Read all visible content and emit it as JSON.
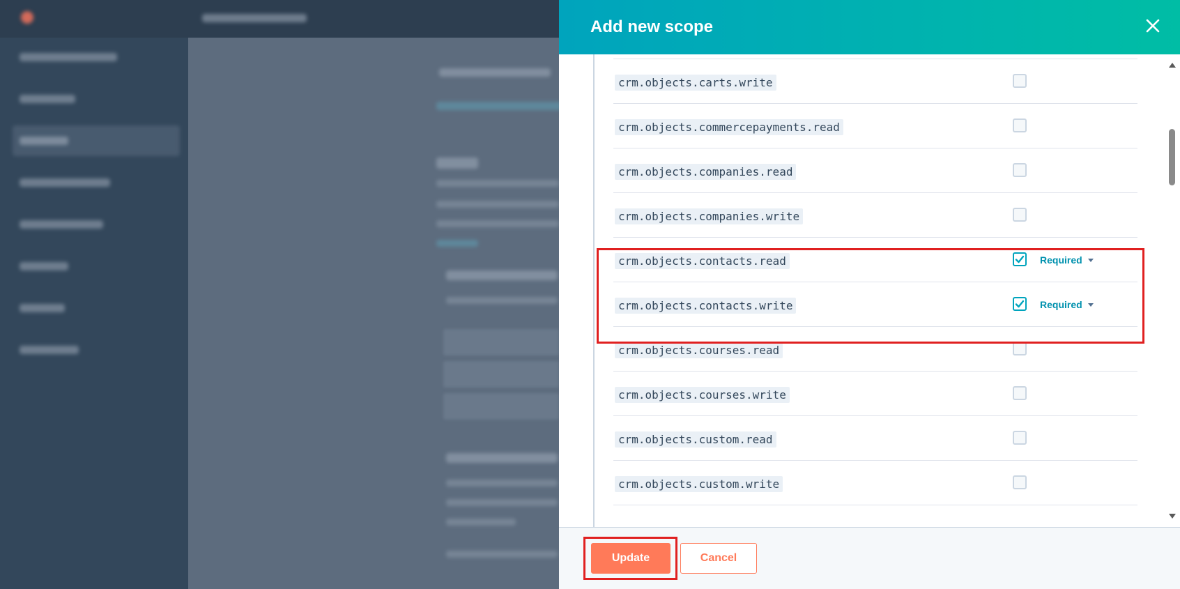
{
  "panel": {
    "title": "Add new scope",
    "close_icon": "close-icon"
  },
  "scopes": [
    {
      "name": "crm.objects.carts.write",
      "checked": false,
      "required_label": ""
    },
    {
      "name": "crm.objects.commercepayments.read",
      "checked": false,
      "required_label": ""
    },
    {
      "name": "crm.objects.companies.read",
      "checked": false,
      "required_label": ""
    },
    {
      "name": "crm.objects.companies.write",
      "checked": false,
      "required_label": ""
    },
    {
      "name": "crm.objects.contacts.read",
      "checked": true,
      "required_label": "Required"
    },
    {
      "name": "crm.objects.contacts.write",
      "checked": true,
      "required_label": "Required"
    },
    {
      "name": "crm.objects.courses.read",
      "checked": false,
      "required_label": ""
    },
    {
      "name": "crm.objects.courses.write",
      "checked": false,
      "required_label": ""
    },
    {
      "name": "crm.objects.custom.read",
      "checked": false,
      "required_label": ""
    },
    {
      "name": "crm.objects.custom.write",
      "checked": false,
      "required_label": ""
    }
  ],
  "footer": {
    "update_label": "Update",
    "cancel_label": "Cancel"
  },
  "colors": {
    "header_gradient_start": "#00a4bd",
    "header_gradient_end": "#00bda5",
    "primary_button": "#ff7a59",
    "checkbox_checked": "#00a4bd",
    "highlight": "#e02020"
  }
}
